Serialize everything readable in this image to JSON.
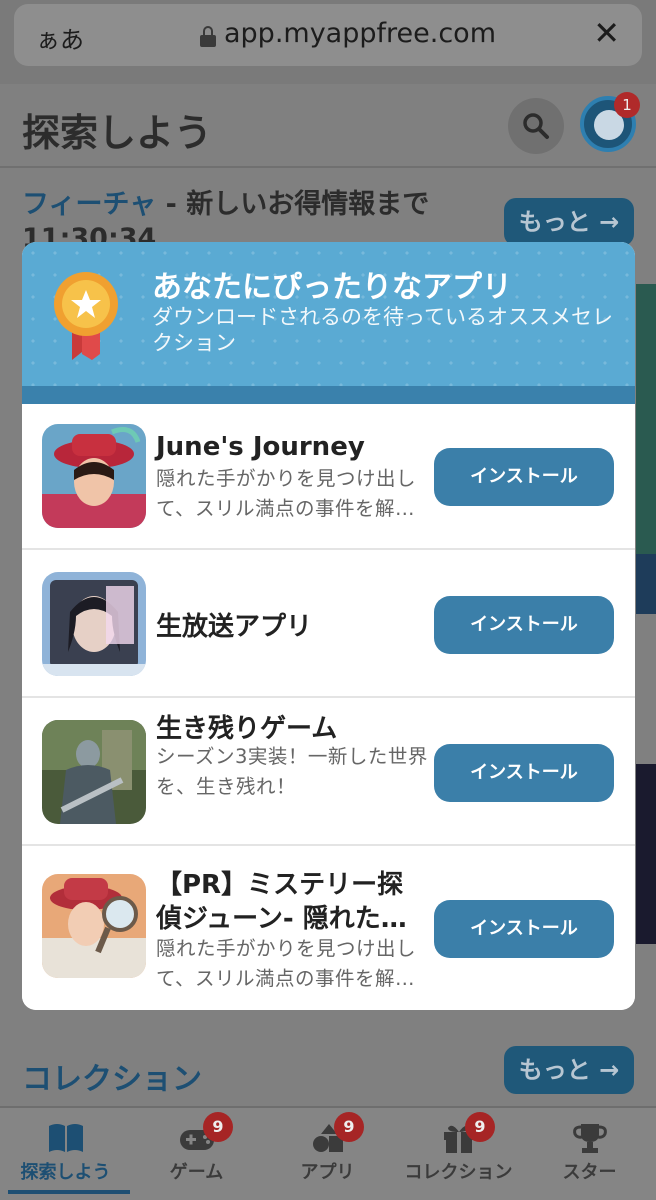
{
  "browser": {
    "text_size_label": "ぁあ",
    "url": "app.myappfree.com",
    "close_label": "✕"
  },
  "header": {
    "title": "探索しよう",
    "notification_count": "1"
  },
  "featured": {
    "label": "フィーチャ",
    "rest": " - 新しいお得情報まで",
    "countdown": "11:30:34",
    "more_label": "もっと →"
  },
  "modal": {
    "title": "あなたにぴったりなアプリ",
    "subtitle": "ダウンロードされるのを待っているオススメセレクション",
    "apps": [
      {
        "name": "June's Journey",
        "description": "隠れた手がかりを見つけ出して、スリル満点の事件を解…",
        "install_label": "インストール"
      },
      {
        "name": "生放送アプリ",
        "description": "",
        "install_label": "インストール"
      },
      {
        "name": "生き残りゲーム",
        "description": "シーズン3実装！一新した世界を、生き残れ！",
        "install_label": "インストール"
      },
      {
        "name": "【PR】ミステリー探偵ジューン- 隠れた…",
        "description": "隠れた手がかりを見つけ出して、スリル満点の事件を解…",
        "install_label": "インストール"
      }
    ]
  },
  "collection": {
    "title": "コレクション",
    "more_label": "もっと →"
  },
  "tabs": [
    {
      "label": "探索しよう",
      "icon": "book-icon",
      "active": true
    },
    {
      "label": "ゲーム",
      "icon": "gamepad-icon",
      "badge": "9"
    },
    {
      "label": "アプリ",
      "icon": "shapes-icon",
      "badge": "9"
    },
    {
      "label": "コレクション",
      "icon": "gift-icon",
      "badge": "9"
    },
    {
      "label": "スター",
      "icon": "trophy-icon"
    }
  ],
  "colors": {
    "accent": "#3b7fa9",
    "modal_header": "#5aaad3",
    "badge_red": "#a62525"
  }
}
